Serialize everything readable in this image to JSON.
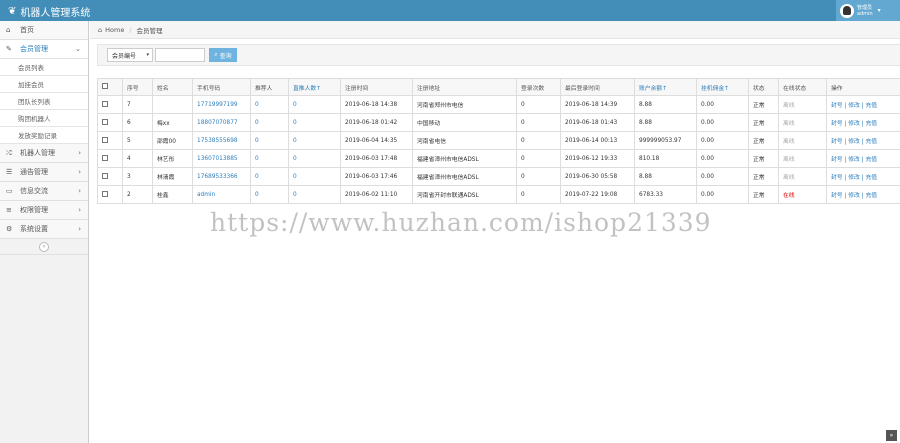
{
  "app": {
    "title": "机器人管理系统"
  },
  "user": {
    "name": "管理员",
    "role": "admin"
  },
  "sidebar": {
    "items": [
      {
        "label": "首页",
        "icon": "dashboard-icon",
        "glyph": "⌂",
        "has_arrow": false
      },
      {
        "label": "会员管理",
        "icon": "edit-icon",
        "glyph": "✎",
        "has_arrow": true,
        "active": true
      },
      {
        "label": "机器人管理",
        "icon": "shuffle-icon",
        "glyph": "⤮",
        "has_arrow": true
      },
      {
        "label": "通告管理",
        "icon": "bullhorn-icon",
        "glyph": "☰",
        "has_arrow": true
      },
      {
        "label": "信息交流",
        "icon": "desktop-icon",
        "glyph": "▭",
        "has_arrow": true
      },
      {
        "label": "权限管理",
        "icon": "list-icon",
        "glyph": "≡",
        "has_arrow": true
      },
      {
        "label": "系统设置",
        "icon": "cog-icon",
        "glyph": "⚙",
        "has_arrow": true
      }
    ],
    "sub_items": [
      "会员列表",
      "加挂会员",
      "团队长列表",
      "购团机器人",
      "发放奖励记录"
    ]
  },
  "breadcrumb": {
    "home": "Home",
    "current": "会员管理"
  },
  "filter": {
    "select_value": "会员编号",
    "search_label": "查询"
  },
  "table": {
    "headers": [
      "序号",
      "姓名",
      "手机号码",
      "推荐人",
      "直推人数↑",
      "注册时间",
      "注册地址",
      "登录次数",
      "最后登录时间",
      "账户余额↑",
      "挂机佣金↑",
      "状态",
      "在线状态",
      "操作"
    ],
    "rows": [
      {
        "id": "7",
        "name": "",
        "phone": "17719997199",
        "ref": "0",
        "direct": "0",
        "reg_time": "2019-06-18 14:38",
        "addr": "河南省郑州市电信",
        "logins": "0",
        "last_login": "2019-06-18 14:39",
        "balance": "8.88",
        "commission": "0.00",
        "status": "正常",
        "online": "离线",
        "ops": "封号 | 修改 | 充值"
      },
      {
        "id": "6",
        "name": "梅xx",
        "phone": "18807070877",
        "ref": "0",
        "direct": "0",
        "reg_time": "2019-06-18 01:42",
        "addr": "中国移动",
        "logins": "0",
        "last_login": "2019-06-18 01:43",
        "balance": "8.88",
        "commission": "0.00",
        "status": "正常",
        "online": "离线",
        "ops": "封号 | 修改 | 充值"
      },
      {
        "id": "5",
        "name": "邵霞00",
        "phone": "17538555698",
        "ref": "0",
        "direct": "0",
        "reg_time": "2019-06-04 14:35",
        "addr": "河南省电信",
        "logins": "0",
        "last_login": "2019-06-14 00:13",
        "balance": "999999053.97",
        "commission": "0.00",
        "status": "正常",
        "online": "离线",
        "ops": "封号 | 修改 | 充值"
      },
      {
        "id": "4",
        "name": "林艺彤",
        "phone": "13607013885",
        "ref": "0",
        "direct": "0",
        "reg_time": "2019-06-03 17:48",
        "addr": "福建省漳州市电信ADSL",
        "logins": "0",
        "last_login": "2019-06-12 19:33",
        "balance": "810.18",
        "commission": "0.00",
        "status": "正常",
        "online": "离线",
        "ops": "封号 | 修改 | 充值"
      },
      {
        "id": "3",
        "name": "林清霞",
        "phone": "17689533366",
        "ref": "0",
        "direct": "0",
        "reg_time": "2019-06-03 17:46",
        "addr": "福建省漳州市电信ADSL",
        "logins": "0",
        "last_login": "2019-06-30 05:58",
        "balance": "8.88",
        "commission": "0.00",
        "status": "正常",
        "online": "离线",
        "ops": "封号 | 修改 | 充值"
      },
      {
        "id": "2",
        "name": "桂鑫",
        "phone": "admin",
        "ref": "0",
        "direct": "0",
        "reg_time": "2019-06-02 11:10",
        "addr": "河南省开封市联通ADSL",
        "logins": "0",
        "last_login": "2019-07-22 19:08",
        "balance": "6783.33",
        "commission": "0.00",
        "status": "正常",
        "online": "在线",
        "ops": "封号 | 修改 | 充值"
      }
    ]
  },
  "watermark": "https://www.huzhan.com/ishop21339",
  "colors": {
    "topbar": "#438eb9",
    "link": "#2b7dbc",
    "online": "#dd0000"
  }
}
